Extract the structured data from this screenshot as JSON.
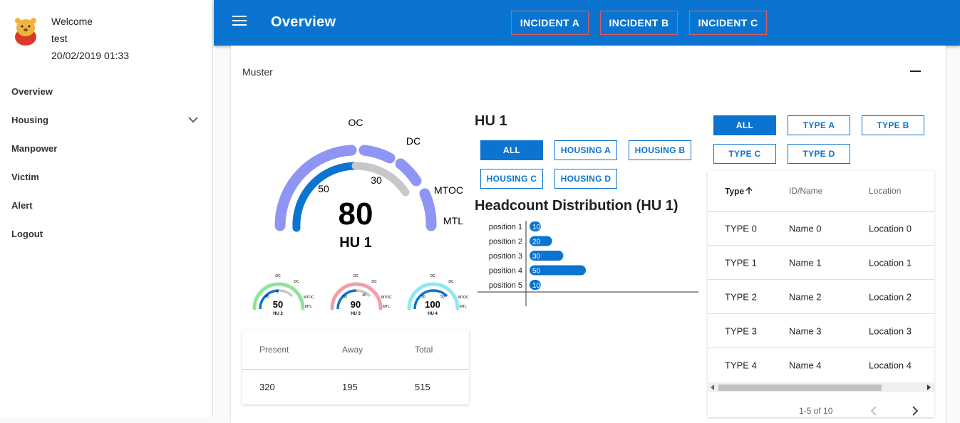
{
  "user": {
    "welcome": "Welcome",
    "name": "test",
    "datetime": "20/02/2019 01:33"
  },
  "nav": [
    {
      "label": "Overview"
    },
    {
      "label": "Housing"
    },
    {
      "label": "Manpower"
    },
    {
      "label": "Victim"
    },
    {
      "label": "Alert"
    },
    {
      "label": "Logout"
    }
  ],
  "topbar": {
    "title": "Overview",
    "incidents": [
      "INCIDENT A",
      "INCIDENT B",
      "INCIDENT C"
    ]
  },
  "card": {
    "title": "Muster"
  },
  "main_gauge": {
    "value": "80",
    "label": "HU 1",
    "ticks": {
      "oc": "OC",
      "dc": "DC",
      "mtoc": "MTOC",
      "mtl": "MTL",
      "t50": "50",
      "t30": "30"
    }
  },
  "small_gauges": [
    {
      "value": "50",
      "label": "HU 2",
      "t1": "45",
      "t2": "5",
      "color": "#8fe39b"
    },
    {
      "value": "90",
      "label": "HU 3",
      "t1": "50",
      "t2": "40",
      "color": "#f19ea6"
    },
    {
      "value": "100",
      "label": "HU 4",
      "t1": "50",
      "t2": "50",
      "color": "#8ee8ef"
    }
  ],
  "small_gauge_ticks": {
    "oc": "OC",
    "dc": "DC",
    "mtoc": "MTOC",
    "mtl": "MTL"
  },
  "summary": {
    "headers": [
      "Present",
      "Away",
      "Total"
    ],
    "values": [
      "320",
      "195",
      "515"
    ]
  },
  "hu_panel": {
    "title": "HU 1",
    "filters": [
      "ALL",
      "HOUSING A",
      "HOUSING B",
      "HOUSING C",
      "HOUSING D"
    ],
    "active": "ALL"
  },
  "distribution": {
    "title": "Headcount Distribution (HU 1)"
  },
  "chart_data": {
    "type": "bar",
    "orientation": "horizontal",
    "title": "Headcount Distribution (HU 1)",
    "categories": [
      "position 1",
      "position 2",
      "position 3",
      "position 4",
      "position 5"
    ],
    "values": [
      10,
      20,
      30,
      50,
      10
    ],
    "bar_color": "#0b74d1",
    "xlim": [
      0,
      150
    ]
  },
  "type_filters": {
    "buttons": [
      "ALL",
      "TYPE A",
      "TYPE B",
      "TYPE C",
      "TYPE D"
    ],
    "active": "ALL"
  },
  "table": {
    "headers": [
      "Type",
      "ID/Name",
      "Location"
    ],
    "sort_icon": "arrow-up-icon",
    "rows": [
      [
        "TYPE 0",
        "Name 0",
        "Location 0"
      ],
      [
        "TYPE 1",
        "Name 1",
        "Location 1"
      ],
      [
        "TYPE 2",
        "Name 2",
        "Location 2"
      ],
      [
        "TYPE 3",
        "Name 3",
        "Location 3"
      ],
      [
        "TYPE 4",
        "Name 4",
        "Location 4"
      ]
    ],
    "pagination": "1-5 of 10"
  },
  "colors": {
    "primary": "#0b74d1",
    "gauge_outer": "#8f95f2",
    "gauge_gray": "#c7c7c7"
  }
}
